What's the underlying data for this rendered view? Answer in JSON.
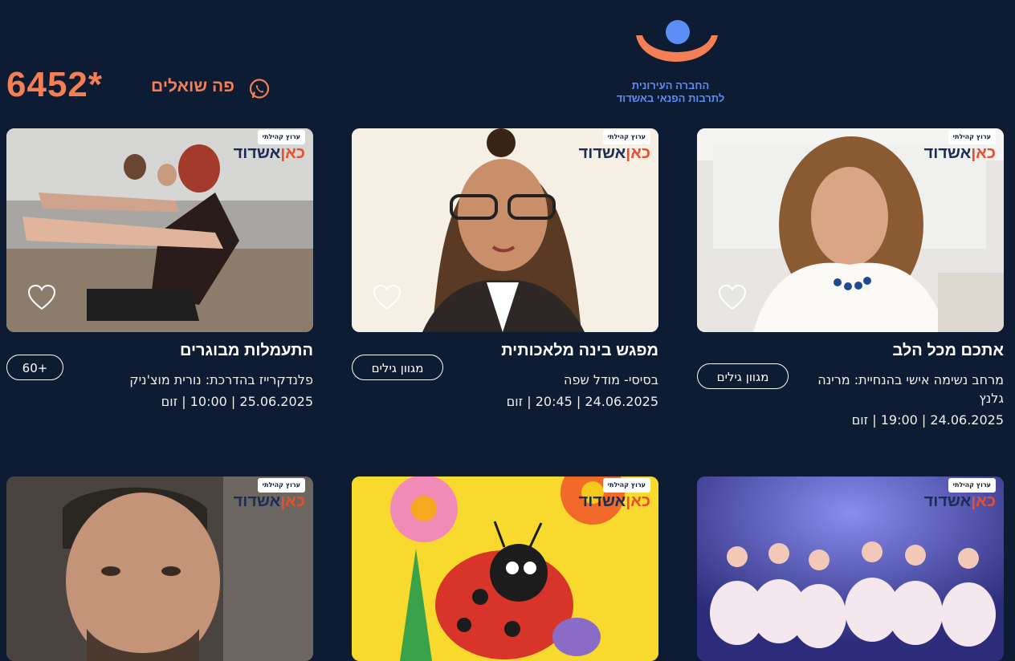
{
  "header": {
    "phone": "6452*",
    "ask_label": "פה שואלים",
    "logo_line1": "החברה העירונית",
    "logo_line2": "לתרבות הפנאי באשדוד",
    "icons": {
      "whatsapp": "whatsapp-icon",
      "logo": "org-logo"
    }
  },
  "brand": {
    "badge": "ערוץ קהילתי",
    "logo_a": "כאן",
    "logo_b": "אשדוד"
  },
  "colors": {
    "background": "#0d1b33",
    "accent": "#f47f55",
    "logo_blue": "#5b8ef5"
  },
  "cards": [
    {
      "title": "אתכם מכל הלב",
      "subtitle": "מרחב נשימה אישי בהנחיית: מרינה גלנץ",
      "meta": "24.06.2025 | 19:00 | זום",
      "tag": "מגוון גילים"
    },
    {
      "title": "מפגש בינה מלאכותית",
      "subtitle": "בסיסי- מודל שפה",
      "meta": "24.06.2025 | 20:45 | זום",
      "tag": "מגוון גילים"
    },
    {
      "title": "התעמלות מבוגרים",
      "subtitle": "פלנדקרייז בהדרכת: נורית מוצ'ניק",
      "meta": "25.06.2025 | 10:00 | זום",
      "tag": "+60"
    }
  ]
}
